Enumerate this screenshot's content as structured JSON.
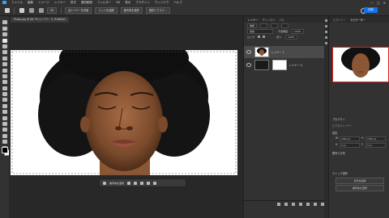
{
  "menubar": {
    "app_icon": "ps-home-icon",
    "items": [
      "ファイル",
      "編集",
      "イメージ",
      "レイヤー",
      "書式",
      "選択範囲",
      "フィルター",
      "3D",
      "表示",
      "プラグイン",
      "ウィンドウ",
      "ヘルプ"
    ],
    "window_controls": [
      "—",
      "□",
      "✕"
    ]
  },
  "options": {
    "tool_icon": "quick-selection-icon",
    "size_value": "30",
    "sample_all_label": "全レイヤーを対象",
    "enhance_edge_label": "エッジを強調",
    "select_subject_label": "被写体を選択",
    "select_mask_label": "選択とマスク...",
    "share_label": "共有"
  },
  "document": {
    "tab_title": "Photo.jpg @ 66.7% (レイヤー 0, RGB/8#)"
  },
  "taskbar": {
    "label": "被写体を選択"
  },
  "layers_panel": {
    "tabs": [
      "レイヤー",
      "チャンネル",
      "パス"
    ],
    "filter_label": "種類",
    "blend_mode": "通常",
    "opacity_label": "不透明度:",
    "opacity_value": "100%",
    "lock_label": "ロック:",
    "fill_label": "塗り:",
    "fill_value": "100%",
    "layers": [
      {
        "name": "レイヤー 1",
        "selected": true
      },
      {
        "name": "レイヤー 0",
        "selected": false
      }
    ]
  },
  "right_panel": {
    "tabs": [
      "ヒストリー",
      "ナビゲーター"
    ],
    "properties_title": "プロパティ",
    "props_tabs": [
      "ピクセルレイヤー"
    ],
    "transform_label": "変形",
    "w_label": "W",
    "w_value": "1920 px",
    "h_label": "H",
    "h_value": "1280 px",
    "x_label": "X",
    "x_value": "0 px",
    "y_label": "Y",
    "y_value": "0 px",
    "align_label": "整列と分布",
    "quick_actions_label": "クイック操作",
    "btn_remove_bg": "背景を削除",
    "btn_select_subject": "被写体を選択"
  }
}
